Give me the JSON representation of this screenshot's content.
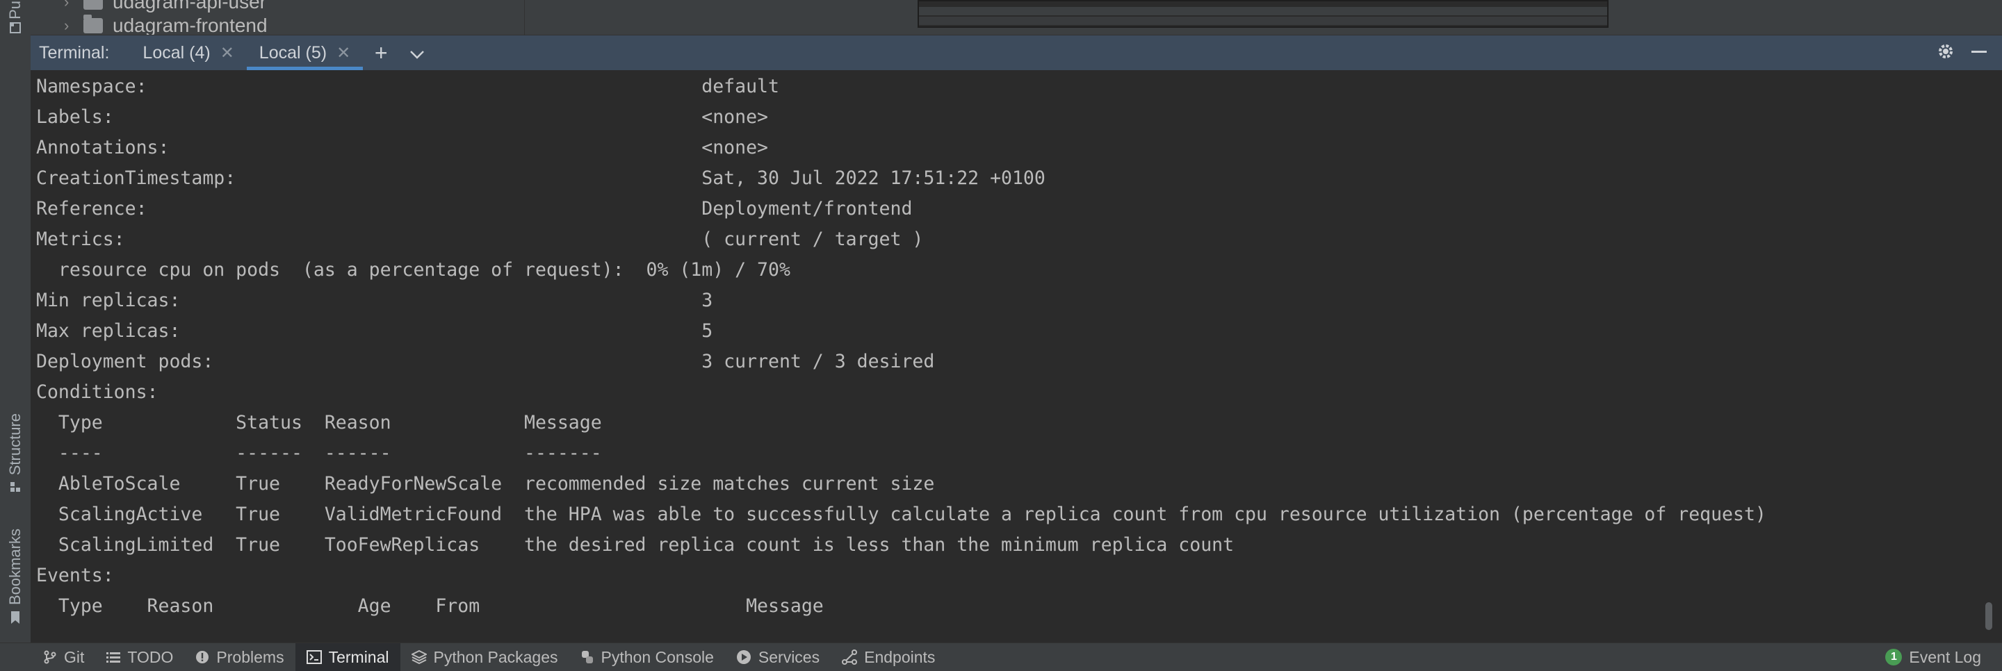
{
  "left_strip": {
    "top_label": "Pu",
    "structure_label": "Structure",
    "bookmarks_label": "Bookmarks"
  },
  "project_tree": {
    "items": [
      {
        "label": "udagram-api-user",
        "icon": "folder-icon"
      },
      {
        "label": "udagram-frontend",
        "icon": "folder-icon"
      }
    ]
  },
  "terminal": {
    "title": "Terminal:",
    "tabs": [
      {
        "label": "Local (4)",
        "active": false
      },
      {
        "label": "Local (5)",
        "active": true
      }
    ],
    "add_icon": "plus-icon",
    "dropdown_icon": "chevron-down-icon",
    "settings_icon": "gear-icon",
    "hide_icon": "minimize-icon",
    "lines": [
      "Namespace:                                                  default",
      "Labels:                                                     <none>",
      "Annotations:                                                <none>",
      "CreationTimestamp:                                          Sat, 30 Jul 2022 17:51:22 +0100",
      "Reference:                                                  Deployment/frontend",
      "Metrics:                                                    ( current / target )",
      "  resource cpu on pods  (as a percentage of request):  0% (1m) / 70%",
      "Min replicas:                                               3",
      "Max replicas:                                               5",
      "Deployment pods:                                            3 current / 3 desired",
      "Conditions:",
      "  Type            Status  Reason            Message",
      "  ----            ------  ------            -------",
      "  AbleToScale     True    ReadyForNewScale  recommended size matches current size",
      "  ScalingActive   True    ValidMetricFound  the HPA was able to successfully calculate a replica count from cpu resource utilization (percentage of request)",
      "  ScalingLimited  True    TooFewReplicas    the desired replica count is less than the minimum replica count",
      "Events:",
      "  Type    Reason             Age    From                        Message"
    ]
  },
  "bottom_bar": {
    "items": [
      {
        "label": "Git",
        "icon": "git-branch-icon",
        "active": false
      },
      {
        "label": "TODO",
        "icon": "list-icon",
        "active": false
      },
      {
        "label": "Problems",
        "icon": "problems-icon",
        "active": false
      },
      {
        "label": "Terminal",
        "icon": "terminal-icon",
        "active": true
      },
      {
        "label": "Python Packages",
        "icon": "packages-icon",
        "active": false
      },
      {
        "label": "Python Console",
        "icon": "python-icon",
        "active": false
      },
      {
        "label": "Services",
        "icon": "services-icon",
        "active": false
      },
      {
        "label": "Endpoints",
        "icon": "endpoints-icon",
        "active": false
      }
    ],
    "event_log": {
      "label": "Event Log",
      "count": "1"
    }
  },
  "colors": {
    "terminal_bg": "#2b2b2b",
    "header_bg": "#3d4b5c",
    "active_tab_underline": "#4a88c7",
    "event_badge": "#499c54"
  }
}
